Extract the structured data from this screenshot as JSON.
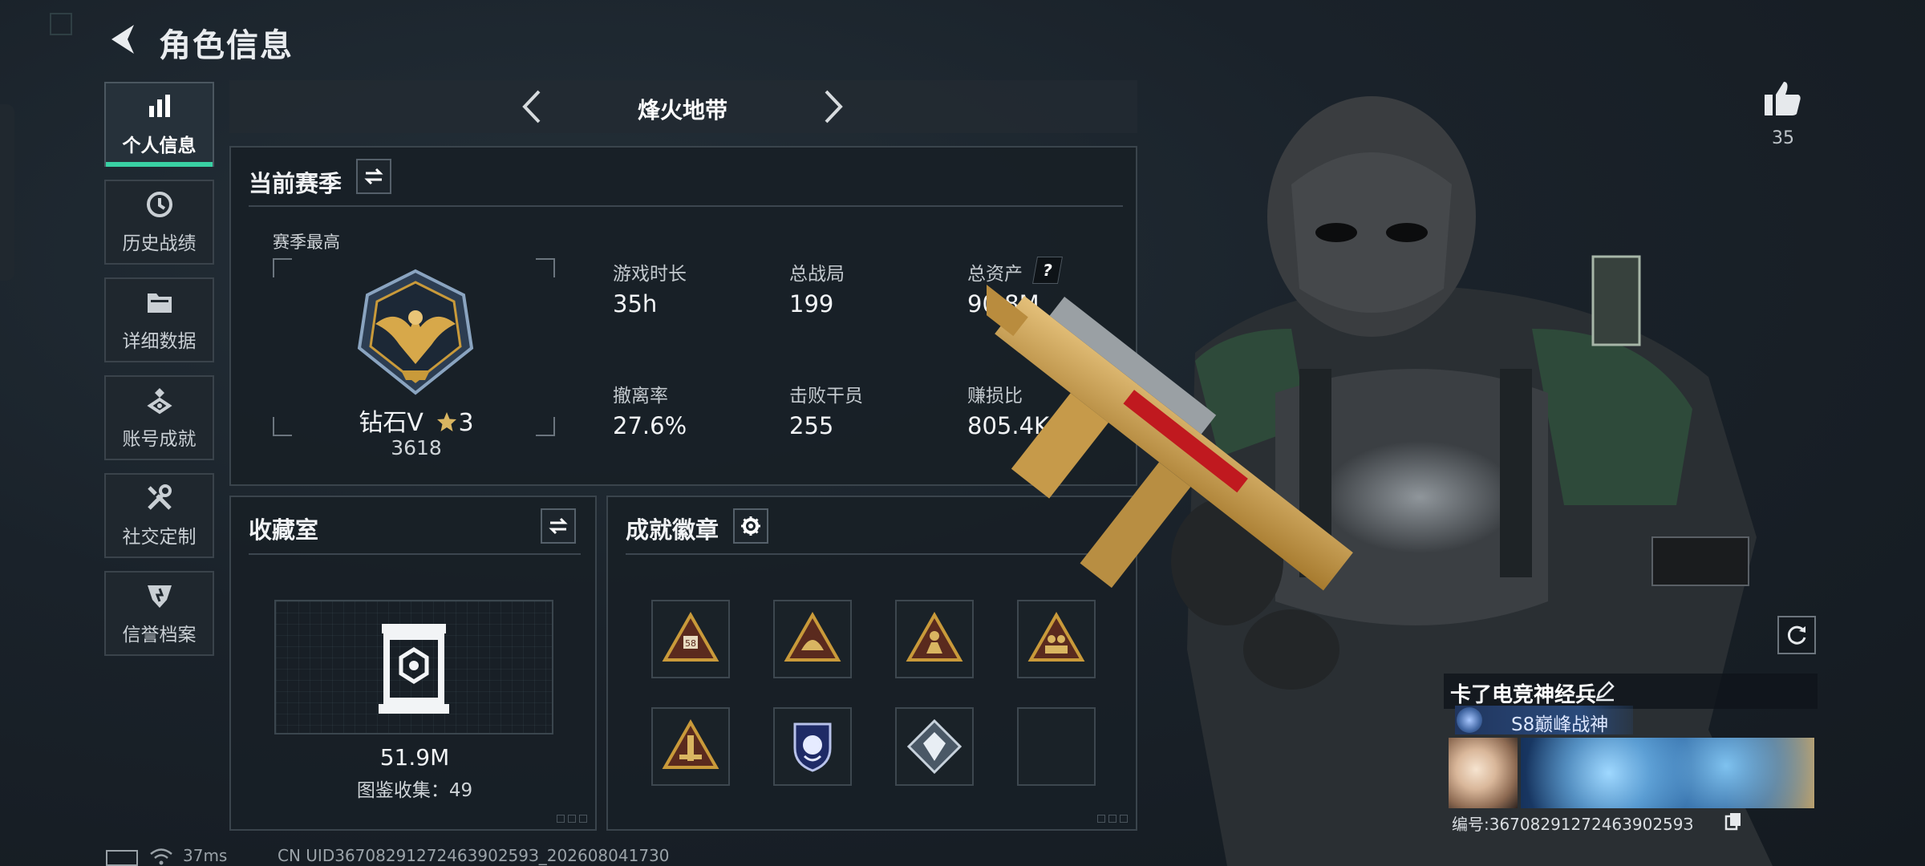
{
  "header": {
    "title": "角色信息"
  },
  "nav": {
    "items": [
      {
        "label": "个人信息",
        "icon": "bar-chart-icon",
        "active": true
      },
      {
        "label": "历史战绩",
        "icon": "history-clock-icon",
        "active": false
      },
      {
        "label": "详细数据",
        "icon": "folder-icon",
        "active": false
      },
      {
        "label": "账号成就",
        "icon": "achievement-icon",
        "active": false
      },
      {
        "label": "社交定制",
        "icon": "tools-icon",
        "active": false
      },
      {
        "label": "信誉档案",
        "icon": "shield-badge-icon",
        "active": false
      }
    ]
  },
  "mode": {
    "title": "烽火地带"
  },
  "season": {
    "title": "当前赛季",
    "best_label": "赛季最高",
    "rank_name": "钻石V",
    "rank_stars": "3",
    "rank_score": "3618",
    "stats": [
      {
        "label": "游戏时长",
        "value": "35h"
      },
      {
        "label": "总战局",
        "value": "199"
      },
      {
        "label": "总资产",
        "value": "90.8M",
        "help": "?"
      },
      {
        "label": "撤离率",
        "value": "27.6%"
      },
      {
        "label": "击败干员",
        "value": "255"
      },
      {
        "label": "赚损比",
        "value": "805.4K"
      }
    ]
  },
  "collection": {
    "title": "收藏室",
    "value": "51.9M",
    "count_text": "图鉴收集：49"
  },
  "badges": {
    "title": "成就徽章",
    "items": [
      {
        "icon": "triangle-58-badge-icon"
      },
      {
        "icon": "triangle-helmet-badge-icon"
      },
      {
        "icon": "triangle-soldier-badge-icon"
      },
      {
        "icon": "triangle-squad-badge-icon"
      },
      {
        "icon": "triangle-tower-badge-icon"
      },
      {
        "icon": "lion-shield-badge-icon"
      },
      {
        "icon": "diamond-crystal-badge-icon"
      },
      {
        "icon": "empty-slot"
      }
    ]
  },
  "social": {
    "likes": "35",
    "player_name": "卡了电竞神经兵",
    "title_badge": "S8巅峰战神",
    "player_id": "编号:3670829127246390259З"
  },
  "status": {
    "ping": "37ms",
    "uid": "CN UID3670829127246390259З_202608041730"
  },
  "colors": {
    "accent": "#39d1a3",
    "panel_border": "#3a444c",
    "gold": "#c99a3a"
  }
}
